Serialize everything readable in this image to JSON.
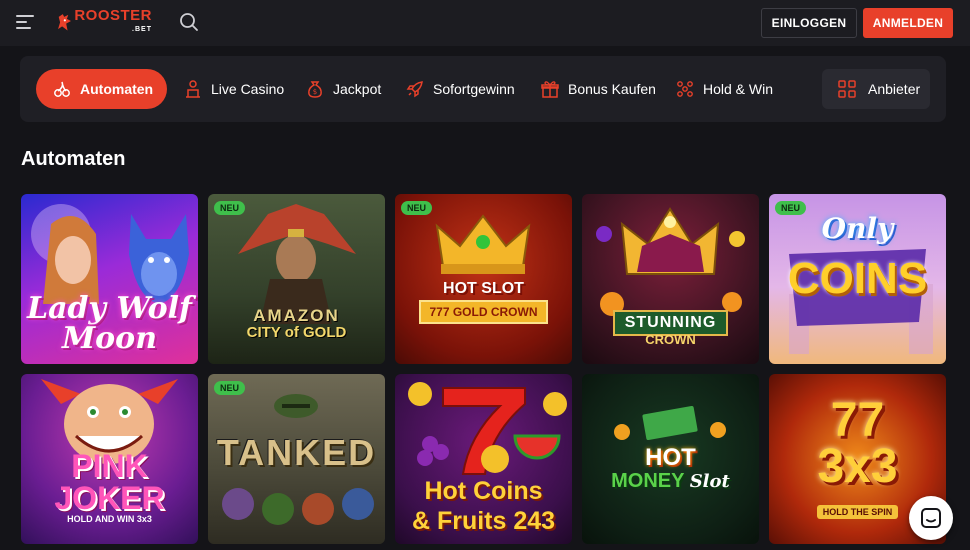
{
  "header": {
    "logo_text": "ROOSTER",
    "logo_sub": ".BET",
    "login_label": "EINLOGGEN",
    "register_label": "ANMELDEN"
  },
  "categories": [
    {
      "label": "Automaten",
      "icon": "cherries-icon",
      "active": true
    },
    {
      "label": "Live Casino",
      "icon": "dealer-icon",
      "active": false
    },
    {
      "label": "Jackpot",
      "icon": "moneybag-icon",
      "active": false
    },
    {
      "label": "Sofortgewinn",
      "icon": "rocket-icon",
      "active": false
    },
    {
      "label": "Bonus Kaufen",
      "icon": "gift-icon",
      "active": false
    },
    {
      "label": "Hold & Win",
      "icon": "dots-icon",
      "active": false
    }
  ],
  "provider_label": "Anbieter",
  "section_title": "Automaten",
  "games": [
    {
      "title_line1": "Lady Wolf",
      "title_line2": "Moon",
      "new": false
    },
    {
      "title_line1": "AMAZON",
      "title_line2": "CITY of GOLD",
      "new": true,
      "badge": "NEU"
    },
    {
      "title_line1": "HOT SLOT",
      "title_line2": "777 GOLD CROWN",
      "new": true,
      "badge": "NEU"
    },
    {
      "title_line1": "STUNNING",
      "title_line2": "CROWN",
      "new": false
    },
    {
      "title_line1": "Only",
      "title_line2": "COINS",
      "new": true,
      "badge": "NEU"
    },
    {
      "title_line1": "PINK",
      "title_line2": "JOKER",
      "title_line3": "HOLD AND WIN 3x3",
      "new": false
    },
    {
      "title_line1": "TANKED",
      "title_line2": "",
      "new": true,
      "badge": "NEU"
    },
    {
      "title_line1": "Hot Coins",
      "title_line2": "& Fruits 243",
      "new": false
    },
    {
      "title_line1": "HOT",
      "title_line2": "MONEY",
      "title_line3": "Slot",
      "new": false
    },
    {
      "title_line1": "77",
      "title_line2": "3x3",
      "title_line3": "HOLD THE SPIN",
      "new": false
    }
  ],
  "colors": {
    "accent": "#e8402a",
    "badge": "#3fbf4b",
    "background": "#141418"
  }
}
